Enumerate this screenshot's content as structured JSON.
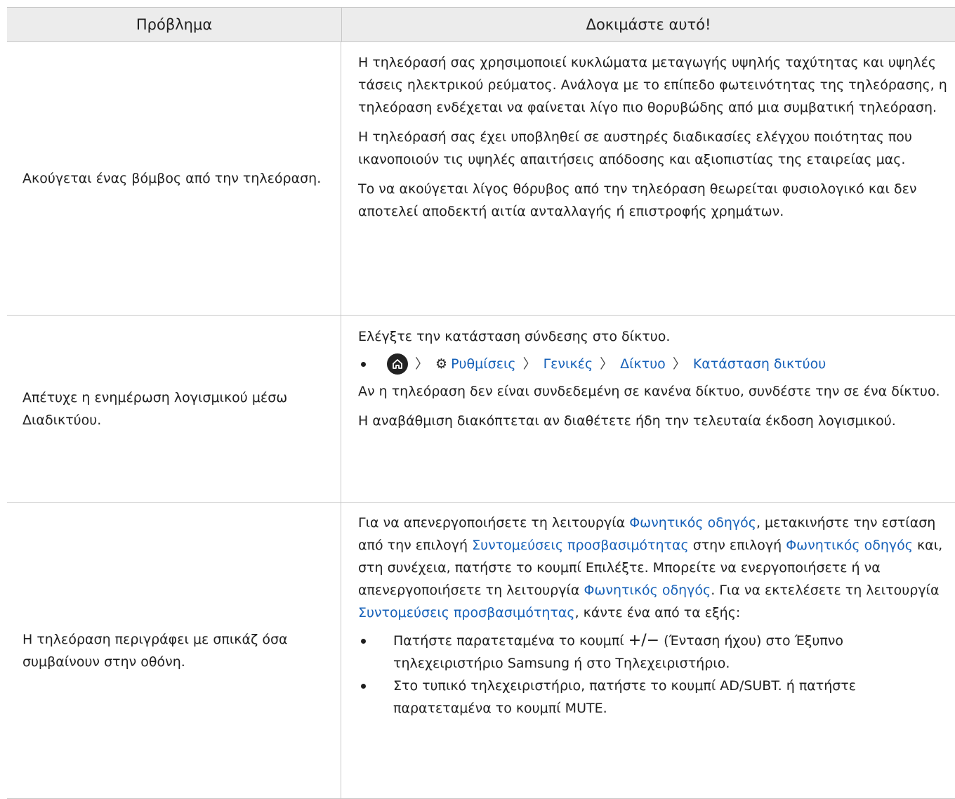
{
  "header": {
    "problem": "Πρόβλημα",
    "solution": "Δοκιμάστε αυτό!"
  },
  "rows": [
    {
      "problem": "Ακούγεται ένας βόμβος από την τηλεόραση.",
      "p1": "Η τηλεόρασή σας χρησιμοποιεί κυκλώματα μεταγωγής υψηλής ταχύτητας και υψηλές τάσεις ηλεκτρικού ρεύματος. Ανάλογα με το επίπεδο φωτεινότητας της τηλεόρασης, η τηλεόραση ενδέχεται να φαίνεται λίγο πιο θορυβώδης από μια συμβατική τηλεόραση.",
      "p2": "Η τηλεόρασή σας έχει υποβληθεί σε αυστηρές διαδικασίες ελέγχου ποιότητας που ικανοποιούν τις υψηλές απαιτήσεις απόδοσης και αξιοπιστίας της εταιρείας μας.",
      "p3": "Το να ακούγεται λίγος θόρυβος από την τηλεόραση θεωρείται φυσιολογικό και δεν αποτελεί αποδεκτή αιτία ανταλλαγής ή επιστροφής χρημάτων."
    },
    {
      "problem": "Απέτυχε η ενημέρωση λογισμικού μέσω Διαδικτύου.",
      "p1": "Ελέγξτε την κατάσταση σύνδεσης στο δίκτυο.",
      "crumb": {
        "settings": "Ρυθμίσεις",
        "general": "Γενικές",
        "network": "Δίκτυο",
        "status": "Κατάσταση δικτύου"
      },
      "p2": "Αν η τηλεόραση δεν είναι συνδεδεμένη σε κανένα δίκτυο, συνδέστε την σε ένα δίκτυο.",
      "p3": "Η αναβάθμιση διακόπτεται αν διαθέτετε ήδη την τελευταία έκδοση λογισμικού."
    },
    {
      "problem": "Η τηλεόραση περιγράφει με σπικάζ όσα συμβαίνουν στην οθόνη.",
      "t1": "Για να απενεργοποιήσετε τη λειτουργία ",
      "voice_guide": "Φωνητικός οδηγός",
      "t2": ", μετακινήστε την εστίαση από την επιλογή ",
      "shortcuts": "Συντομεύσεις προσβασιμότητας",
      "t3": " στην επιλογή ",
      "t4": " και, στη συνέχεια, πατήστε το κουμπί Επιλέξτε. Μπορείτε να ενεργοποιήσετε ή να απενεργοποιήσετε τη λειτουργία ",
      "t5": ". Για να εκτελέσετε τη λειτουργία ",
      "t6": ", κάντε ένα από τα εξής:",
      "b1_pre": "Πατήστε παρατεταμένα το κουμπί ",
      "b1_sym": "+/−",
      "b1_post": " (Ένταση ήχου) στο Έξυπνο τηλεχειριστήριο Samsung ή στο Τηλεχειριστήριο.",
      "b2": "Στο τυπικό τηλεχειριστήριο, πατήστε το κουμπί AD/SUBT. ή πατήστε παρατεταμένα το κουμπί MUTE."
    }
  ]
}
